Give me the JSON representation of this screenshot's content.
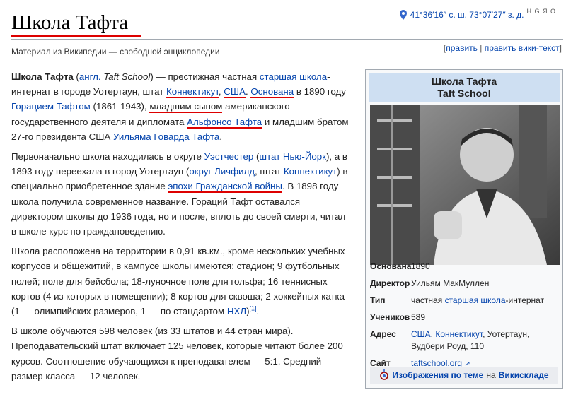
{
  "header": {
    "title": "Школа Тафта",
    "tagline": "Материал из Википедии — свободной энциклопедии",
    "coords": "41°36′16″ с. ш. 73°07′27″ з. д.",
    "coords_extra": "H G Я O",
    "edit": "править",
    "separator": " | ",
    "edit_source": "править вики-текст"
  },
  "article": {
    "p1": {
      "t1": "Школа Тафта",
      "t2": " (",
      "l1": "англ.",
      "t3": " ",
      "t4": "Taft School",
      "t5": ") — престижная частная ",
      "l2": "старшая школа",
      "t6": "-интернат в городе Уотертаун, штат ",
      "l3": "Коннектикут",
      "t7": ", ",
      "l4": "США",
      "t8": ". ",
      "l5": "Основана",
      "t9": " в 1890 году ",
      "l6": "Горацием Тафтом",
      "t10": " (1861-1943), ",
      "l7": "младшим сыном",
      "t11": " американского государственного деятеля и дипломата ",
      "l8": "Альфонсо Тафта",
      "t12": " и младшим братом 27-го президента США ",
      "l9": "Уильяма Говарда Тафта",
      "t13": "."
    },
    "p2": {
      "t1": "Первоначально школа находилась в округе ",
      "l1": "Уэстчестер",
      "t2": " (",
      "l2": "штат Нью-Йорк",
      "t3": "), а в 1893 году переехала в город Уотертаун (",
      "l3": "округ Личфилд",
      "t4": ", штат ",
      "l4": "Коннектикут",
      "t5": ") в специально приобретенное здание ",
      "l5": "эпохи Гражданской войны",
      "t6": ". В 1898 году школа получила современное название. Гораций Тафт оставался директором школы до 1936 года, но и после, вплоть до своей смерти, читал в школе курс по граждановедению."
    },
    "p3": {
      "t1": "Школа расположена на территории в 0,91 кв.км., кроме нескольких учебных корпусов и общежитий, в кампусе школы имеются: стадион; 9 футбольных полей; поле для бейсбола; 18-луночное поле для гольфа; 16 теннисных кортов (4 из которых в помещении); 8 кортов для сквоша; 2 хоккейных катка (1 — олимпийских размеров, 1 — по стандартом ",
      "l1": "НХЛ",
      "t2": ")",
      "ref": "[1]",
      "t3": "."
    },
    "p4": {
      "t1": "В школе обучаются 598 человек (из 33 штатов и 44 стран мира). Преподавательский штат включает 125 человек, которые читают более 200 курсов. Соотношение обучающихся к преподавателем — 5:1. Средний размер класса — 12 человек."
    }
  },
  "infobox": {
    "title": "Школа Тафта",
    "subtitle": "Taft School",
    "rows": {
      "founded": {
        "k": "Основана",
        "v": "1890"
      },
      "director": {
        "k": "Директор",
        "v": "Уильям МакМуллен"
      },
      "type": {
        "k": "Тип",
        "v1": "частная ",
        "l": "старшая школа",
        "v2": "-интернат"
      },
      "students": {
        "k": "Учеников",
        "v": "589"
      },
      "address": {
        "k": "Адрес",
        "l1": "США",
        "v1": ", ",
        "l2": "Коннектикут",
        "v2": ", Уотертаун, Вудбери Роуд, 110"
      },
      "site": {
        "k": "Сайт",
        "l": "taftschool.org"
      }
    },
    "commons": {
      "l1": "Изображения по теме",
      "t": " на ",
      "l2": "Викискладе"
    }
  },
  "colors": {
    "link": "#0645ad",
    "highlight": "#dd0000",
    "infobox_header": "#cedff2"
  }
}
